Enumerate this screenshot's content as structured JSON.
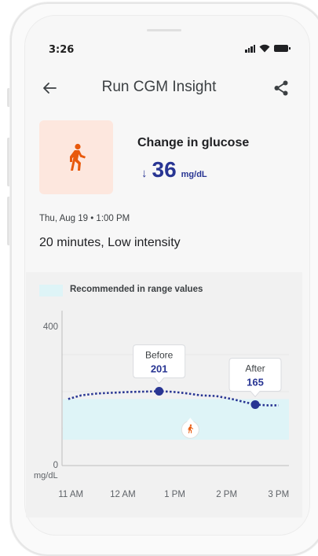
{
  "status_bar": {
    "time": "3:26"
  },
  "app_bar": {
    "title": "Run CGM Insight"
  },
  "summary": {
    "metric_title": "Change in glucose",
    "direction_arrow": "↓",
    "value": "36",
    "unit": "mg/dL",
    "activity_icon": "running-person-icon"
  },
  "session": {
    "datetime": "Thu, Aug 19 • 1:00 PM",
    "description": "20 minutes, Low intensity"
  },
  "chart_data": {
    "type": "line",
    "legend": [
      {
        "label": "Recommended in range values",
        "color": "#def4f7"
      }
    ],
    "y_ticks": [
      "400",
      "0"
    ],
    "y_unit": "mg/dL",
    "ylim": [
      0,
      400
    ],
    "x_labels": [
      "11 AM",
      "12 AM",
      "1 PM",
      "2 PM",
      "3 PM"
    ],
    "range_band": [
      70,
      180
    ],
    "series": [
      {
        "x": [
          10.95,
          11.2,
          11.5,
          11.8,
          12.1,
          12.4,
          12.7,
          12.9,
          13.0,
          13.2,
          13.5,
          13.8,
          14.1,
          14.4,
          14.55,
          14.8,
          15.0
        ],
        "y": [
          180,
          190,
          195,
          197,
          199,
          200,
          201,
          200,
          199,
          196,
          190,
          188,
          180,
          170,
          165,
          163,
          163
        ]
      }
    ],
    "annotations": [
      {
        "label": "Before",
        "value": "201",
        "x": 12.7,
        "y": 201
      },
      {
        "label": "After",
        "value": "165",
        "x": 14.55,
        "y": 165
      }
    ],
    "activity_marker": {
      "icon": "running-person-icon",
      "x": 13.3,
      "y": 110
    },
    "colors": {
      "line": "#283593",
      "band": "#def4f7",
      "marker": "#e8590c"
    }
  }
}
